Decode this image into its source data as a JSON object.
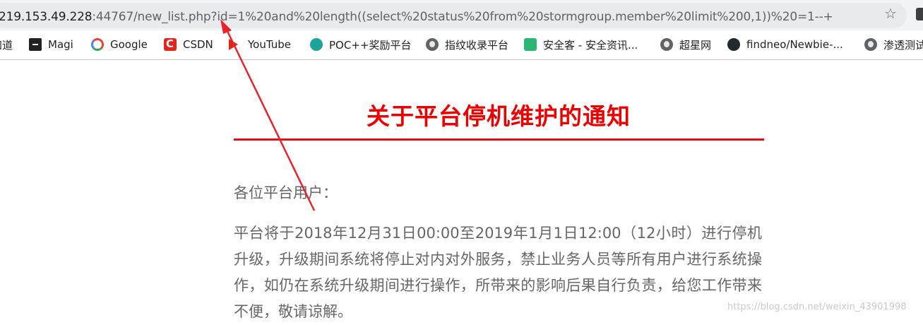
{
  "address_bar": {
    "url_host": "219.153.49.228",
    "url_rest": ":44767/new_list.php?id=1%20and%20length((select%20status%20from%20stormgroup.member%20limit%200,1))%20=1--+"
  },
  "bookmarks": [
    {
      "label": "知道",
      "icon": "partial-bookmark"
    },
    {
      "label": "Magi",
      "icon": "magi-icon"
    },
    {
      "label": "Google",
      "icon": "google-icon"
    },
    {
      "label": "CSDN",
      "icon": "csdn-icon"
    },
    {
      "label": "YouTube",
      "icon": "youtube-icon"
    },
    {
      "label": "POC++奖励平台",
      "icon": "poc-icon"
    },
    {
      "label": "指纹收录平台",
      "icon": "globe-icon"
    },
    {
      "label": "安全客 - 安全资讯...",
      "icon": "anquanke-icon"
    },
    {
      "label": "超星网",
      "icon": "globe-icon"
    },
    {
      "label": "findneo/Newbie-...",
      "icon": "github-icon"
    },
    {
      "label": "渗透测试",
      "icon": "globe-icon"
    }
  ],
  "article": {
    "title": "关于平台停机维护的通知",
    "greeting": "各位平台用户：",
    "body": "平台将于2018年12月31日00:00至2019年1月1日12:00（12小时）进行停机升级，升级期间系统将停止对内对外服务，禁止业务人员等所有用户进行系统操作，如仍在系统升级期间进行操作，所带来的影响后果自行负责，给您工作带来不便，敬请谅解。"
  },
  "watermark": "https://blog.csdn.net/weixin_43901998",
  "colors": {
    "title": "#ee0000",
    "rule": "#e40f14",
    "annotation_arrow": "#e8232a"
  }
}
